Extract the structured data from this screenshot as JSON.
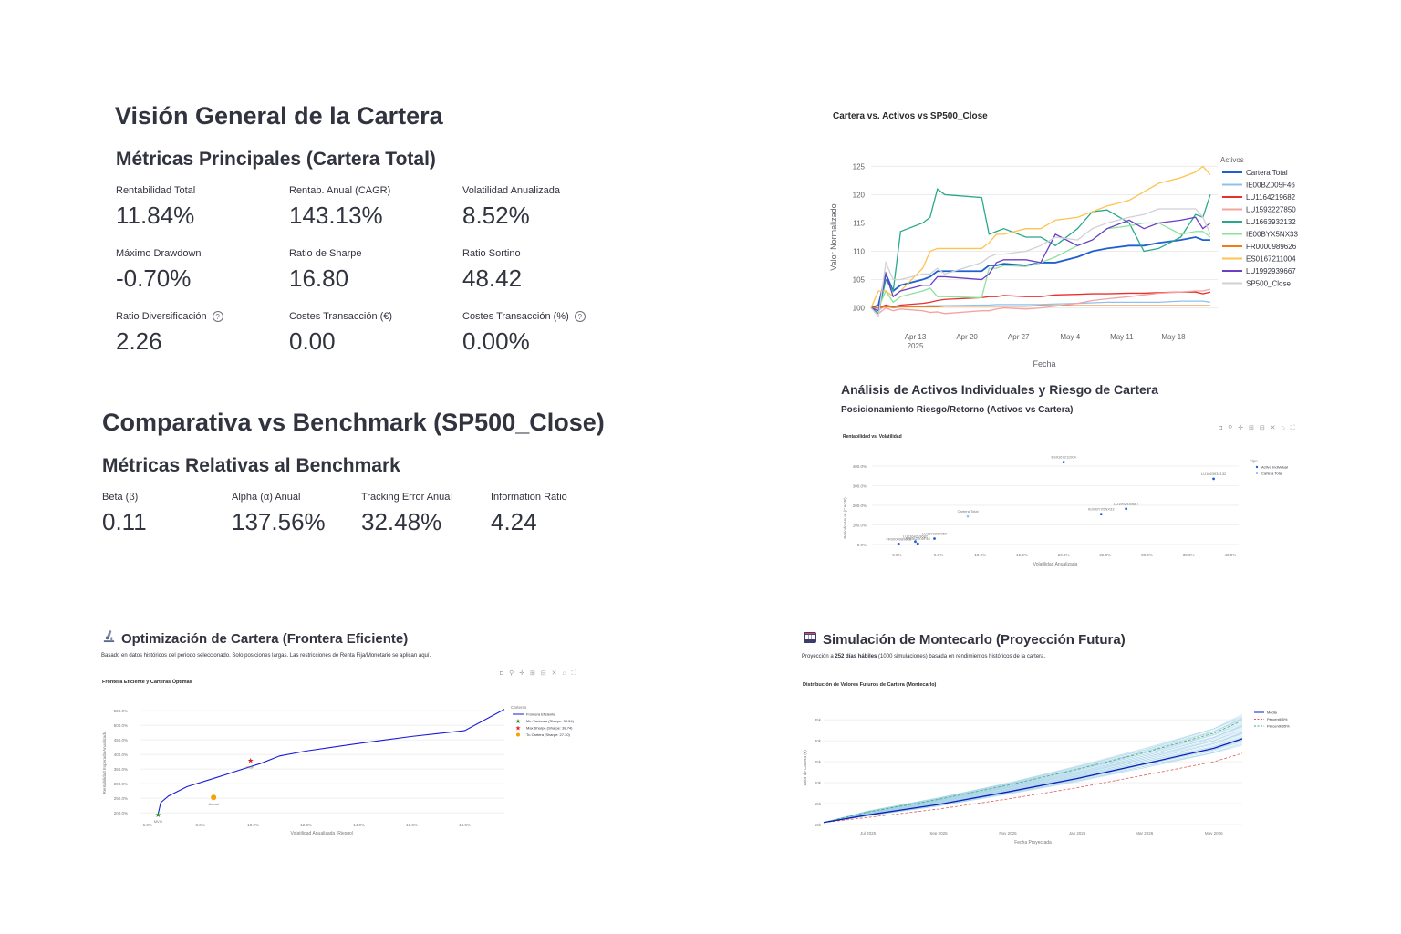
{
  "overview": {
    "title": "Visión General de la Cartera",
    "subtitle": "Métricas Principales (Cartera Total)",
    "metrics": [
      {
        "label": "Rentabilidad Total",
        "value": "11.84%",
        "help": false
      },
      {
        "label": "Rentab. Anual (CAGR)",
        "value": "143.13%",
        "help": false
      },
      {
        "label": "Volatilidad Anualizada",
        "value": "8.52%",
        "help": false
      },
      {
        "label": "Máximo Drawdown",
        "value": "-0.70%",
        "help": false
      },
      {
        "label": "Ratio de Sharpe",
        "value": "16.80",
        "help": false
      },
      {
        "label": "Ratio Sortino",
        "value": "48.42",
        "help": false
      },
      {
        "label": "Ratio Diversificación",
        "value": "2.26",
        "help": true
      },
      {
        "label": "Costes Transacción (€)",
        "value": "0.00",
        "help": false
      },
      {
        "label": "Costes Transacción (%)",
        "value": "0.00%",
        "help": true
      }
    ]
  },
  "benchmark": {
    "title": "Comparativa vs Benchmark (SP500_Close)",
    "subtitle": "Métricas Relativas al Benchmark",
    "metrics": [
      {
        "label": "Beta (β)",
        "value": "0.11"
      },
      {
        "label": "Alpha (α) Anual",
        "value": "137.56%"
      },
      {
        "label": "Tracking Error Anual",
        "value": "32.48%"
      },
      {
        "label": "Information Ratio",
        "value": "4.24"
      }
    ]
  },
  "help_icon": "question-circle-icon",
  "toolbar_icons": "◘ ⚲ ✛ ⊞ ⊟ ✕ ⌂ ⛶",
  "line_chart": {
    "title": "Cartera vs. Activos vs SP500_Close",
    "ylabel": "Valor Normalizado",
    "xlabel": "Fecha",
    "yticks": [
      "100",
      "105",
      "110",
      "115",
      "120",
      "125"
    ],
    "xticks": [
      "Apr 13",
      "Apr 20",
      "Apr 27",
      "May 4",
      "May 11",
      "May 18"
    ],
    "xtick_year": "2025",
    "legend_title": "Activos",
    "colors": {
      "Cartera Total": "#1f5fd1",
      "IE00BZ005F46": "#8ec1ef",
      "LU1164219682": "#e8302e",
      "LU1593227850": "#f4a3a3",
      "LU1663932132": "#27a98a",
      "IE00BYX5NX33": "#8be39a",
      "FR0000989626": "#f07c16",
      "ES0167211004": "#ffc24d",
      "LU1992939667": "#6a3fc6",
      "SP500_Close": "#d0d0d6"
    }
  },
  "analysis": {
    "title": "Análisis de Activos Individuales y Riesgo de Cartera",
    "subtitle": "Posicionamiento Riesgo/Retorno (Activos vs Cartera)"
  },
  "scatter_chart": {
    "title": "Rentabilidad vs. Volatilidad",
    "ylabel": "Periodo Anual (CAGR)",
    "xlabel": "Volatilidad Anualizada",
    "yticks": [
      "0.0%",
      "100.0%",
      "200.0%",
      "300.0%",
      "400.0%"
    ],
    "xticks": [
      "0.0%",
      "5.0%",
      "10.0%",
      "15.0%",
      "20.0%",
      "25.0%",
      "30.0%",
      "35.0%",
      "40.0%"
    ],
    "legend_title": "Tipo",
    "legend": [
      "Activo Individual",
      "Cartera Total"
    ],
    "point_labels": [
      "ES0167211004",
      "LU1663932132",
      "Cartera Total",
      "LU1992939667",
      "IE00BYX5NX33",
      "LU1593227850",
      "FR0000989626",
      "LU1164219682",
      "IE00BZ005F46"
    ]
  },
  "frontier": {
    "title": "Optimización de Cartera (Frontera Eficiente)",
    "icon": "microscope-icon",
    "caption": "Basado en datos históricos del periodo seleccionado. Solo posiciones largas. Las restricciones de Renta Fija/Monetario se aplican aquí.",
    "chart_title": "Frontera Eficiente y Carteras Óptimas",
    "ylabel": "Rentabilidad Esperada Anualizada",
    "xlabel": "Volatilidad Anualizada (Riesgo)",
    "yticks": [
      "200.0%",
      "250.0%",
      "300.0%",
      "350.0%",
      "400.0%",
      "450.0%",
      "500.0%",
      "550.0%"
    ],
    "xticks": [
      "6.0%",
      "8.0%",
      "10.0%",
      "12.0%",
      "14.0%",
      "16.0%",
      "18.0%"
    ],
    "legend_title": "Carteras",
    "legend": [
      "Frontera Eficiente",
      "Min Varianza (Sharpe: 30.54)",
      "Max Sharpe (Sharpe: 38.74)",
      "Tu Cartera (Sharpe: 27.30)"
    ],
    "point_labels": [
      "MVO",
      "MSR",
      "Actual"
    ]
  },
  "montecarlo": {
    "title": "Simulación de Montecarlo (Proyección Futura)",
    "icon": "slot-machine-icon",
    "caption_pre": "Proyección a ",
    "caption_bold": "252 días hábiles",
    "caption_post": " (1000 simulaciones) basada en rendimientos históricos de la cartera.",
    "chart_title": "Distribución de Valores Futuros de Cartera (Montecarlo)",
    "ylabel": "Valor de Cartera (€)",
    "xlabel": "Fecha Proyectada",
    "yticks": [
      "10k",
      "15k",
      "20k",
      "25k",
      "30k",
      "35k"
    ],
    "xticks": [
      "Jul 2025",
      "Sep 2025",
      "Nov 2025",
      "Jan 2026",
      "Mar 2026",
      "May 2026"
    ],
    "legend": [
      "Media",
      "Percentil 5%",
      "Percentil 95%"
    ]
  },
  "chart_data": [
    {
      "type": "line",
      "title": "Cartera vs. Activos vs SP500_Close",
      "xlabel": "Fecha",
      "ylabel": "Valor Normalizado",
      "x": [
        "2025-04-07",
        "2025-04-08",
        "2025-04-09",
        "2025-04-10",
        "2025-04-11",
        "2025-04-14",
        "2025-04-15",
        "2025-04-16",
        "2025-04-17",
        "2025-04-22",
        "2025-04-23",
        "2025-04-24",
        "2025-04-25",
        "2025-04-28",
        "2025-04-30",
        "2025-05-02",
        "2025-05-05",
        "2025-05-07",
        "2025-05-09",
        "2025-05-12",
        "2025-05-14",
        "2025-05-16",
        "2025-05-19",
        "2025-05-21",
        "2025-05-22",
        "2025-05-23"
      ],
      "ylim": [
        98,
        127
      ],
      "grid": true,
      "legend_position": "right",
      "series": [
        {
          "name": "Cartera Total",
          "values": [
            100,
            100.5,
            106,
            103,
            104,
            105,
            105.5,
            106.5,
            106.5,
            106.5,
            107.5,
            107.5,
            107.8,
            107.5,
            108,
            108,
            109,
            110,
            110.5,
            111,
            111,
            111.5,
            112,
            112.5,
            112,
            112
          ]
        },
        {
          "name": "IE00BZ005F46",
          "values": [
            100,
            99.5,
            100.5,
            100,
            100.2,
            100.3,
            100.4,
            100.4,
            100.4,
            100.5,
            100.5,
            100.6,
            100.6,
            100.6,
            100.6,
            100.7,
            100.8,
            100.9,
            101,
            101,
            101,
            101,
            101.2,
            101.2,
            101.2,
            101
          ]
        },
        {
          "name": "LU1164219682",
          "values": [
            100,
            100,
            100.5,
            100.2,
            100.5,
            100.8,
            101,
            101.3,
            101.5,
            101.8,
            102,
            102,
            102.2,
            102,
            102,
            102.3,
            102.4,
            102.5,
            102.5,
            102.6,
            102.6,
            102.7,
            102.8,
            102.8,
            102.5,
            102.8
          ]
        },
        {
          "name": "LU1593227850",
          "values": [
            100,
            99,
            100,
            99.5,
            99.8,
            99.5,
            99.2,
            99.3,
            99,
            99.5,
            99.5,
            99.8,
            100,
            99.8,
            100,
            100.3,
            100.8,
            101.3,
            101.6,
            102,
            102.3,
            102.6,
            102.8,
            103,
            103,
            103.3
          ]
        },
        {
          "name": "LU1663932132",
          "values": [
            100,
            99,
            105,
            103,
            113.5,
            115,
            116,
            121,
            120,
            119.5,
            113,
            113.5,
            114,
            112.5,
            112.5,
            111,
            114,
            117,
            117.3,
            115,
            110,
            110.5,
            112.5,
            116.5,
            116,
            120
          ]
        },
        {
          "name": "IE00BYX5NX33",
          "values": [
            100,
            100,
            103,
            101,
            102,
            103,
            103.5,
            102,
            102,
            101.8,
            107,
            107,
            107.5,
            107.3,
            108,
            109,
            111,
            112,
            114,
            114.5,
            115,
            115,
            113,
            113.5,
            113.5,
            112.5
          ]
        },
        {
          "name": "FR0000989626",
          "values": [
            100,
            100,
            100.2,
            100.1,
            100.2,
            100.2,
            100.2,
            100.2,
            100.3,
            100.3,
            100.3,
            100.3,
            100.3,
            100.3,
            100.4,
            100.4,
            100.4,
            100.4,
            100.4,
            100.4,
            100.4,
            100.4,
            100.4,
            100.4,
            100.4,
            100.4
          ]
        },
        {
          "name": "ES0167211004",
          "values": [
            100,
            103,
            103,
            102,
            103,
            107,
            110,
            110.5,
            110.5,
            110.5,
            111.5,
            113,
            113,
            114,
            114,
            115.5,
            116,
            117,
            118,
            119,
            120.5,
            122,
            123,
            124,
            125,
            123.5
          ]
        },
        {
          "name": "LU1992939667",
          "values": [
            100,
            99.5,
            106,
            102,
            103,
            104,
            104,
            105.5,
            105.5,
            105,
            106,
            108,
            108.5,
            108.5,
            108,
            113,
            111,
            112,
            114,
            115.5,
            114,
            115,
            115.5,
            116,
            114,
            115
          ]
        },
        {
          "name": "SP500_Close",
          "values": [
            100,
            98.5,
            108,
            105,
            105,
            106,
            106,
            107,
            106,
            108,
            109,
            109.5,
            109.5,
            110,
            111,
            112.5,
            112,
            114,
            115,
            116,
            116.5,
            117.5,
            117.5,
            117.5,
            116,
            113
          ]
        }
      ]
    },
    {
      "type": "scatter",
      "title": "Rentabilidad vs. Volatilidad",
      "xlabel": "Volatilidad Anualizada",
      "ylabel": "Periodo Anual (CAGR)",
      "xlim": [
        -3,
        41
      ],
      "ylim": [
        -5,
        460
      ],
      "series": [
        {
          "name": "Activo Individual",
          "points": [
            {
              "label": "ES0167211004",
              "x": 20,
              "y": 420
            },
            {
              "label": "LU1663932132",
              "x": 38,
              "y": 335
            },
            {
              "label": "LU1992939667",
              "x": 27.5,
              "y": 182
            },
            {
              "label": "IE00BYX5NX33",
              "x": 24.5,
              "y": 155
            },
            {
              "label": "LU1593227850",
              "x": 4.5,
              "y": 30
            },
            {
              "label": "FR0000989626",
              "x": 0.2,
              "y": 3
            },
            {
              "label": "LU1164219682",
              "x": 2.2,
              "y": 15
            },
            {
              "label": "IE00BZ005F46",
              "x": 2.5,
              "y": 4
            }
          ]
        },
        {
          "name": "Cartera Total",
          "points": [
            {
              "label": "Cartera Total",
              "x": 8.5,
              "y": 143
            }
          ]
        }
      ]
    },
    {
      "type": "line",
      "title": "Frontera Eficiente y Carteras Óptimas",
      "xlabel": "Volatilidad Anualizada (Riesgo)",
      "ylabel": "Rentabilidad Esperada Anualizada",
      "xlim": [
        5.7,
        19.5
      ],
      "ylim": [
        185,
        560
      ],
      "series": [
        {
          "name": "Frontera Eficiente",
          "x": [
            6.4,
            6.5,
            6.8,
            7.5,
            8.5,
            9.5,
            10.3,
            11,
            12,
            13,
            14,
            15,
            16,
            17,
            18,
            19.5
          ],
          "y": [
            195,
            235,
            258,
            290,
            318,
            347,
            370,
            395,
            412,
            425,
            438,
            450,
            462,
            472,
            482,
            555
          ]
        }
      ],
      "points": [
        {
          "name": "Min Varianza (Sharpe: 30.54)",
          "label": "MVO",
          "x": 6.4,
          "y": 195
        },
        {
          "name": "Max Sharpe (Sharpe: 38.74)",
          "label": "MSR",
          "x": 9.9,
          "y": 381
        },
        {
          "name": "Tu Cartera (Sharpe: 27.30)",
          "label": "Actual",
          "x": 8.5,
          "y": 253
        }
      ]
    },
    {
      "type": "area",
      "title": "Distribución de Valores Futuros de Cartera (Montecarlo)",
      "xlabel": "Fecha Proyectada",
      "ylabel": "Valor de Cartera (€)",
      "x": [
        "2025-05-23",
        "2025-07-01",
        "2025-09-01",
        "2025-11-01",
        "2026-01-01",
        "2026-03-01",
        "2026-05-01",
        "2026-05-26"
      ],
      "ylim": [
        10000,
        37000
      ],
      "series": [
        {
          "name": "Media",
          "values": [
            10500,
            12300,
            14800,
            17800,
            21000,
            24500,
            28200,
            30500
          ]
        },
        {
          "name": "Percentil 5%",
          "values": [
            10500,
            11700,
            13700,
            16100,
            18800,
            21800,
            25000,
            27000
          ]
        },
        {
          "name": "Percentil 95%",
          "values": [
            10500,
            13000,
            16000,
            19400,
            23200,
            27200,
            31800,
            34800
          ]
        }
      ]
    }
  ]
}
